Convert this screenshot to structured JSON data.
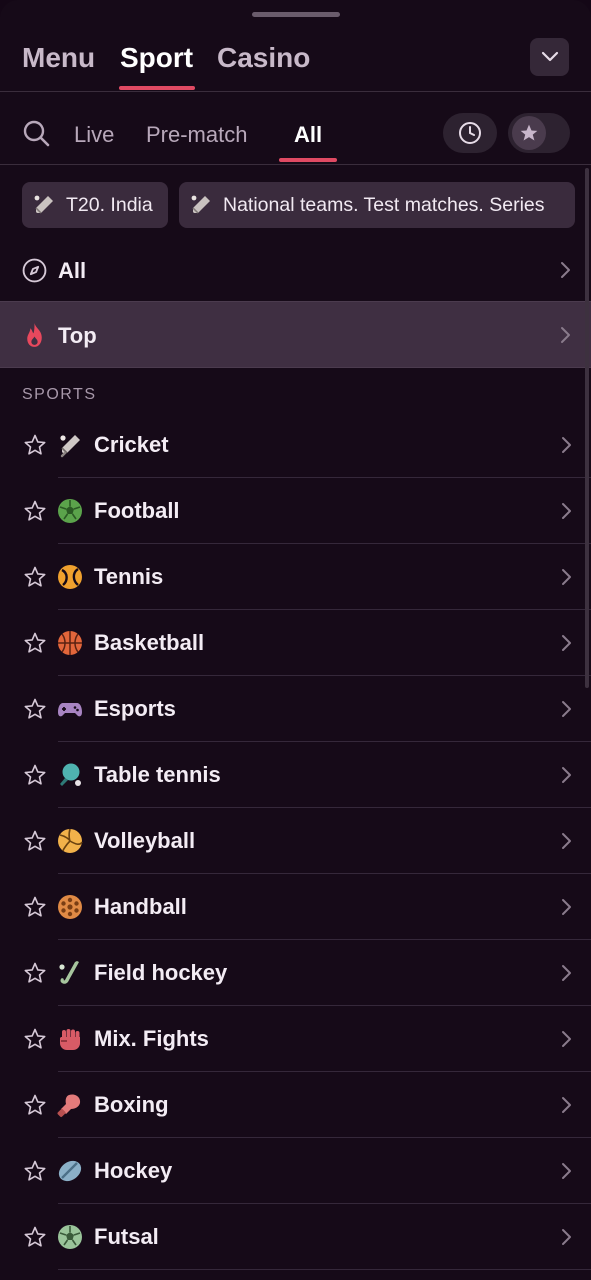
{
  "top_tabs": {
    "menu": "Menu",
    "sport": "Sport",
    "casino": "Casino"
  },
  "filters": {
    "live": "Live",
    "prematch": "Pre-match",
    "all": "All"
  },
  "chips": [
    {
      "label": "T20. India",
      "icon": "cricket-icon"
    },
    {
      "label": "National teams. Test matches. Series",
      "icon": "cricket-icon"
    }
  ],
  "nav": {
    "all": "All",
    "top": "Top"
  },
  "section_title": "SPORTS",
  "sports": [
    {
      "label": "Cricket",
      "icon": "cricket-icon"
    },
    {
      "label": "Football",
      "icon": "football-icon"
    },
    {
      "label": "Tennis",
      "icon": "tennis-icon"
    },
    {
      "label": "Basketball",
      "icon": "basketball-icon"
    },
    {
      "label": "Esports",
      "icon": "gamepad-icon"
    },
    {
      "label": "Table tennis",
      "icon": "table-tennis-icon"
    },
    {
      "label": "Volleyball",
      "icon": "volleyball-icon"
    },
    {
      "label": "Handball",
      "icon": "handball-icon"
    },
    {
      "label": "Field hockey",
      "icon": "field-hockey-icon"
    },
    {
      "label": "Mix. Fights",
      "icon": "fist-icon"
    },
    {
      "label": "Boxing",
      "icon": "boxing-glove-icon"
    },
    {
      "label": "Hockey",
      "icon": "hockey-puck-icon"
    },
    {
      "label": "Futsal",
      "icon": "futsal-icon"
    }
  ],
  "colors": {
    "accent": "#e04a63",
    "background": "#160a18",
    "highlight_row": "#3f2f42"
  }
}
